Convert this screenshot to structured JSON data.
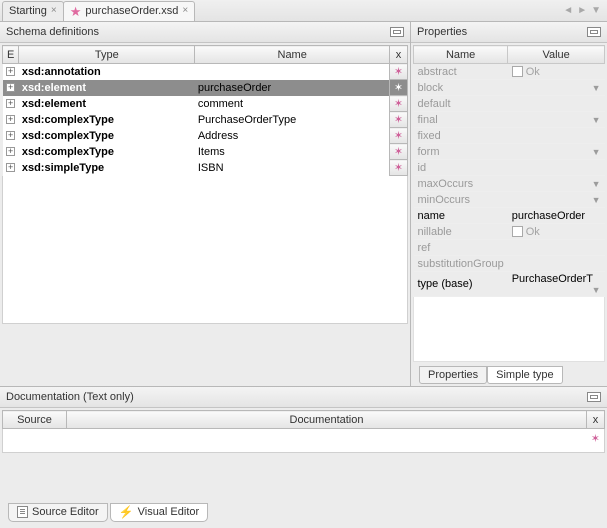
{
  "tabs": {
    "starting_label": "Starting",
    "file_label": "purchaseOrder.xsd"
  },
  "schema": {
    "title": "Schema definitions",
    "headers": {
      "expand": "E",
      "type": "Type",
      "name": "Name",
      "remove": "x"
    },
    "rows": [
      {
        "type": "xsd:annotation",
        "name": ""
      },
      {
        "type": "xsd:element",
        "name": "purchaseOrder",
        "selected": true
      },
      {
        "type": "xsd:element",
        "name": "comment"
      },
      {
        "type": "xsd:complexType",
        "name": "PurchaseOrderType"
      },
      {
        "type": "xsd:complexType",
        "name": "Address"
      },
      {
        "type": "xsd:complexType",
        "name": "Items"
      },
      {
        "type": "xsd:simpleType",
        "name": "ISBN"
      }
    ]
  },
  "properties": {
    "title": "Properties",
    "headers": {
      "name": "Name",
      "value": "Value"
    },
    "rows": [
      {
        "name": "abstract",
        "value": "Ok",
        "checkbox": true
      },
      {
        "name": "block",
        "value": "",
        "dropdown": true
      },
      {
        "name": "default",
        "value": ""
      },
      {
        "name": "final",
        "value": "",
        "dropdown": true
      },
      {
        "name": "fixed",
        "value": ""
      },
      {
        "name": "form",
        "value": "",
        "dropdown": true
      },
      {
        "name": "id",
        "value": ""
      },
      {
        "name": "maxOccurs",
        "value": "",
        "dropdown": true
      },
      {
        "name": "minOccurs",
        "value": "",
        "dropdown": true
      },
      {
        "name": "name",
        "value": "purchaseOrder",
        "strong": true
      },
      {
        "name": "nillable",
        "value": "Ok",
        "checkbox": true
      },
      {
        "name": "ref",
        "value": ""
      },
      {
        "name": "substitutionGroup",
        "value": ""
      },
      {
        "name": "type (base)",
        "value": "PurchaseOrderT",
        "dropdown": true,
        "strong": true
      }
    ],
    "bottom_tabs": {
      "properties": "Properties",
      "simple": "Simple type"
    }
  },
  "documentation": {
    "title": "Documentation (Text only)",
    "headers": {
      "source": "Source",
      "doc": "Documentation",
      "remove": "x"
    }
  },
  "footer": {
    "source_editor": "Source Editor",
    "visual_editor": "Visual Editor"
  }
}
